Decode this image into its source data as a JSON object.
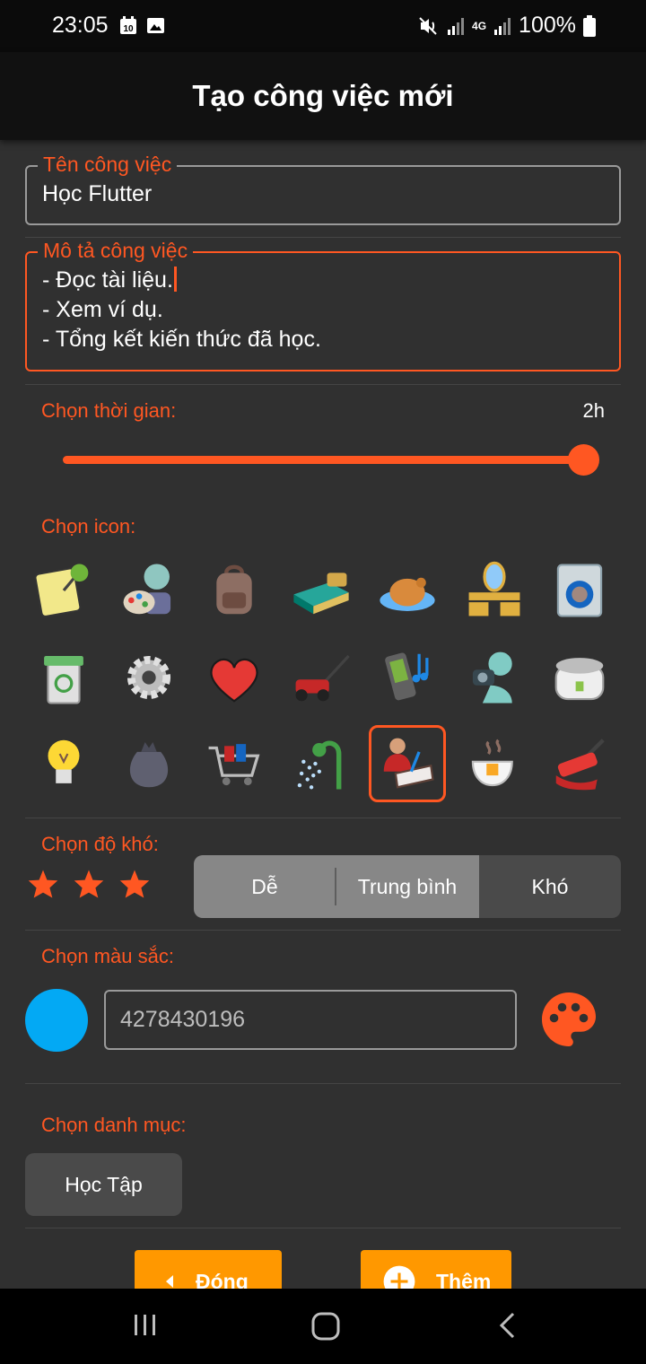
{
  "status_bar": {
    "time": "23:05",
    "calendar_badge": "10",
    "network": "4G",
    "battery": "100%",
    "icons": [
      "calendar-icon",
      "image-icon",
      "mute-icon",
      "signal-icon",
      "battery-icon"
    ]
  },
  "app_bar": {
    "title": "Tạo công việc mới"
  },
  "form": {
    "name_field": {
      "label": "Tên công việc",
      "value": "Học Flutter"
    },
    "description_field": {
      "label": "Mô tả công việc",
      "lines": [
        "- Đọc tài liệu.",
        "- Xem ví dụ.",
        "- Tổng kết kiến thức đã học."
      ]
    },
    "time": {
      "label": "Chọn thời gian:",
      "value_text": "2h",
      "slider_fraction": 1.0
    },
    "icon_picker": {
      "label": "Chọn icon:",
      "selected_index": 18,
      "icons": [
        "sticky-note-pin-icon",
        "artist-palette-icon",
        "backpack-icon",
        "bed-icon",
        "roast-chicken-icon",
        "vanity-mirror-icon",
        "washing-machine-icon",
        "recycle-bin-icon",
        "gear-icon",
        "heart-icon",
        "lawn-mower-icon",
        "music-phone-icon",
        "photographer-icon",
        "rice-cooker-icon",
        "light-bulb-icon",
        "garbage-bag-icon",
        "shopping-cart-icon",
        "shower-icon",
        "reading-person-icon",
        "coffee-cup-icon",
        "paint-roller-icon"
      ]
    },
    "difficulty": {
      "label": "Chọn độ khó:",
      "stars": 3,
      "options": [
        "Dễ",
        "Trung bình",
        "Khó"
      ],
      "selected": [
        "Dễ",
        "Trung bình"
      ]
    },
    "color": {
      "label": "Chọn màu sắc:",
      "value": "4278430196",
      "swatch": "#03a9f4"
    },
    "category": {
      "label": "Chọn danh mục:",
      "value": "Học Tập"
    }
  },
  "actions": {
    "close_label": "Đóng",
    "add_label": "Thêm"
  },
  "colors": {
    "accent": "#ff5722",
    "button": "#ff9800",
    "background": "#303030",
    "app_bar": "#111111"
  },
  "nav_bar": {
    "icons": [
      "recent-apps-icon",
      "home-icon",
      "back-icon"
    ]
  }
}
